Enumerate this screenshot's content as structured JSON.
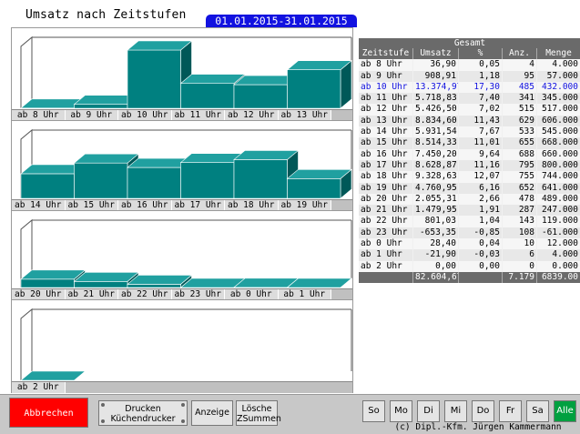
{
  "title": "Umsatz nach Zeitstufen",
  "date_range": "01.01.2015-31.01.2015",
  "colors": {
    "bar": "#008080",
    "bar_top": "#20a0a0",
    "bar_side": "#005858",
    "accent_blue": "#1212e0",
    "cancel_red": "#ff0000",
    "active_green": "#00a040"
  },
  "charts": [
    {
      "labels": [
        "ab  8 Uhr",
        "ab  9 Uhr",
        "ab 10 Uhr",
        "ab 11 Uhr",
        "ab 12 Uhr",
        "ab 13 Uhr"
      ]
    },
    {
      "labels": [
        "ab 14 Uhr",
        "ab 15 Uhr",
        "ab 16 Uhr",
        "ab 17 Uhr",
        "ab 18 Uhr",
        "ab 19 Uhr"
      ]
    },
    {
      "labels": [
        "ab 20 Uhr",
        "ab 21 Uhr",
        "ab 22 Uhr",
        "ab 23 Uhr",
        "ab  0 Uhr",
        "ab  1 Uhr"
      ]
    },
    {
      "labels": [
        "ab  2 Uhr"
      ]
    }
  ],
  "chart_data": {
    "type": "bar",
    "categories": [
      "ab  8 Uhr",
      "ab  9 Uhr",
      "ab 10 Uhr",
      "ab 11 Uhr",
      "ab 12 Uhr",
      "ab 13 Uhr",
      "ab 14 Uhr",
      "ab 15 Uhr",
      "ab 16 Uhr",
      "ab 17 Uhr",
      "ab 18 Uhr",
      "ab 19 Uhr",
      "ab 20 Uhr",
      "ab 21 Uhr",
      "ab 22 Uhr",
      "ab 23 Uhr",
      "ab  0 Uhr",
      "ab  1 Uhr",
      "ab  2 Uhr"
    ],
    "values": [
      36.9,
      908.91,
      13374.97,
      5718.83,
      5426.5,
      8834.6,
      5931.54,
      8514.33,
      7450.2,
      8628.87,
      9328.63,
      4760.95,
      2055.31,
      1479.95,
      801.03,
      -653.35,
      28.4,
      -21.9,
      0.0
    ],
    "ylim": [
      0,
      13374.97
    ]
  },
  "table": {
    "section_title": "Gesamt",
    "headers": [
      "Zeitstufe",
      "Umsatz",
      "%",
      "Anz.",
      "Menge"
    ],
    "rows": [
      [
        "ab  8 Uhr",
        "36,90",
        "0,05",
        "4",
        "4.000"
      ],
      [
        "ab  9 Uhr",
        "908,91",
        "1,18",
        "95",
        "57.000"
      ],
      [
        "ab 10 Uhr",
        "13.374,97",
        "17,30",
        "485",
        "432.000"
      ],
      [
        "ab 11 Uhr",
        "5.718,83",
        "7,40",
        "341",
        "345.000"
      ],
      [
        "ab 12 Uhr",
        "5.426,50",
        "7,02",
        "515",
        "517.000"
      ],
      [
        "ab 13 Uhr",
        "8.834,60",
        "11,43",
        "629",
        "606.000"
      ],
      [
        "ab 14 Uhr",
        "5.931,54",
        "7,67",
        "533",
        "545.000"
      ],
      [
        "ab 15 Uhr",
        "8.514,33",
        "11,01",
        "655",
        "668.000"
      ],
      [
        "ab 16 Uhr",
        "7.450,20",
        "9,64",
        "688",
        "660.000"
      ],
      [
        "ab 17 Uhr",
        "8.628,87",
        "11,16",
        "795",
        "800.000"
      ],
      [
        "ab 18 Uhr",
        "9.328,63",
        "12,07",
        "755",
        "744.000"
      ],
      [
        "ab 19 Uhr",
        "4.760,95",
        "6,16",
        "652",
        "641.000"
      ],
      [
        "ab 20 Uhr",
        "2.055,31",
        "2,66",
        "478",
        "489.000"
      ],
      [
        "ab 21 Uhr",
        "1.479,95",
        "1,91",
        "287",
        "247.000"
      ],
      [
        "ab 22 Uhr",
        "801,03",
        "1,04",
        "143",
        "119.000"
      ],
      [
        "ab 23 Uhr",
        "-653,35",
        "-0,85",
        "108",
        "-61.000"
      ],
      [
        "ab  0 Uhr",
        "28,40",
        "0,04",
        "10",
        "12.000"
      ],
      [
        "ab  1 Uhr",
        "-21,90",
        "-0,03",
        "6",
        "4.000"
      ],
      [
        "ab  2 Uhr",
        "0,00",
        "0,00",
        "0",
        "0.000"
      ]
    ],
    "selected_row": 2,
    "totals": [
      "",
      "82.604,67",
      "",
      "7.179",
      "6839.00"
    ]
  },
  "buttons": {
    "cancel": "Abbrechen",
    "print_line1": "Drucken",
    "print_line2": "Küchendrucker",
    "display": "Anzeige",
    "delete_line1": "Lösche",
    "delete_line2": "ZSummen"
  },
  "days": [
    "So",
    "Mo",
    "Di",
    "Mi",
    "Do",
    "Fr",
    "Sa",
    "Alle"
  ],
  "active_day": "Alle",
  "copyright": "(c) Dipl.-Kfm. Jürgen Kammermann"
}
